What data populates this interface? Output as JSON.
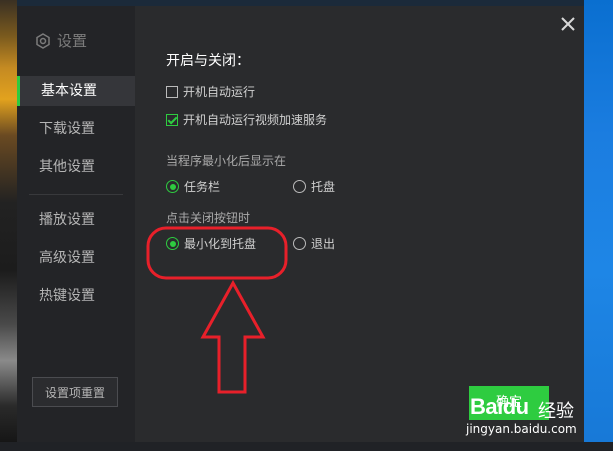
{
  "sidebar": {
    "title": "设置",
    "items": [
      {
        "label": "基本设置",
        "active": true
      },
      {
        "label": "下载设置"
      },
      {
        "label": "其他设置"
      },
      {
        "label": "播放设置"
      },
      {
        "label": "高级设置"
      },
      {
        "label": "热键设置"
      }
    ],
    "reset_label": "设置项重置"
  },
  "content": {
    "section_title": "开启与关闭：",
    "checkboxes": [
      {
        "label": "开机自动运行",
        "checked": false
      },
      {
        "label": "开机自动运行视频加速服务",
        "checked": true
      }
    ],
    "minimize_group": {
      "label": "当程序最小化后显示在",
      "options": [
        {
          "label": "任务栏",
          "selected": true
        },
        {
          "label": "托盘",
          "selected": false
        }
      ]
    },
    "close_group": {
      "label": "点击关闭按钮时",
      "options": [
        {
          "label": "最小化到托盘",
          "selected": true
        },
        {
          "label": "退出",
          "selected": false
        }
      ]
    }
  },
  "confirm_label": "确定",
  "watermark": {
    "logo": "Baidu",
    "cn": "经验",
    "url": "jingyan.baidu.com"
  },
  "colors": {
    "accent": "#2ecc40",
    "annotation": "#e8202a",
    "dialog_bg": "#2a2b2d",
    "sidebar_bg": "#232427"
  },
  "icons": {
    "title_icon": "gear-icon",
    "close": "close-icon"
  }
}
